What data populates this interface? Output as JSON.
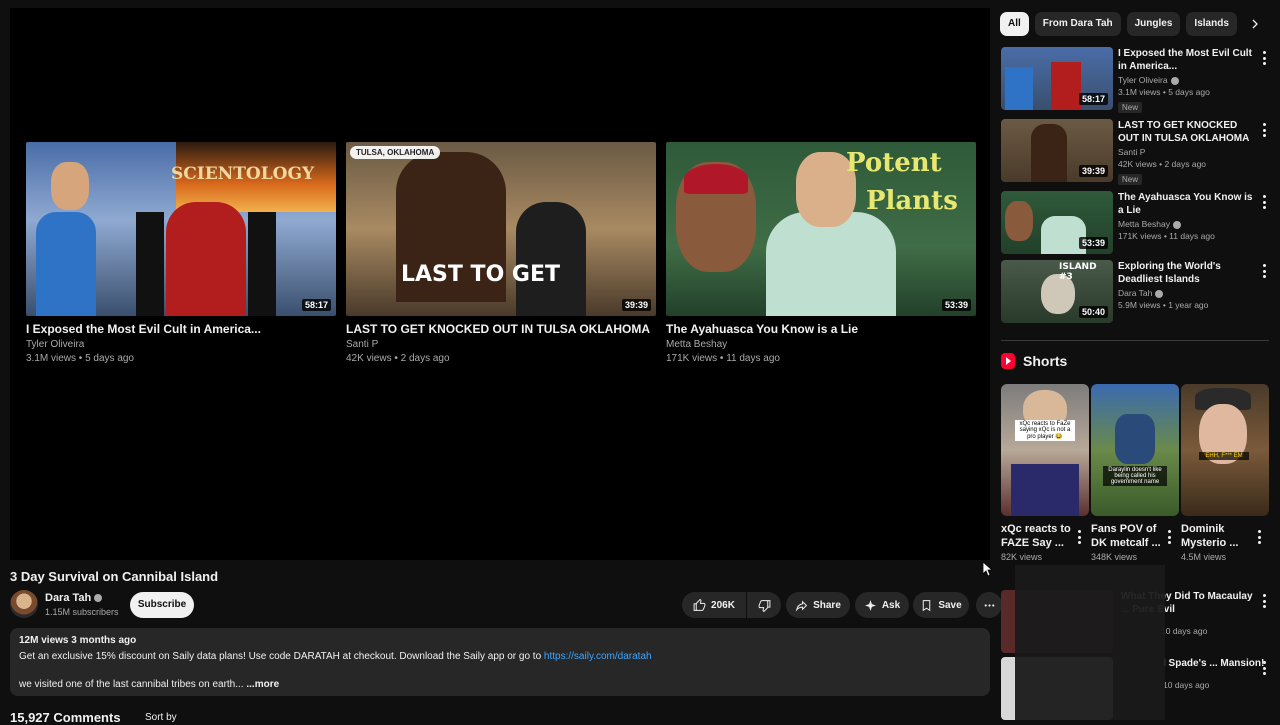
{
  "end_screen": [
    {
      "title": "I Exposed the Most Evil Cult in America...",
      "channel": "Tyler Oliveira",
      "meta": "3.1M views • 5 days ago",
      "duration": "58:17",
      "thumb_text": "SCIENTOLOGY"
    },
    {
      "title": "LAST TO GET KNOCKED OUT IN TULSA OKLAHOMA ‼️ ...",
      "channel": "Santi P",
      "meta": "42K views • 2 days ago",
      "duration": "39:39",
      "location": "TULSA, OKLAHOMA",
      "thumb_text": "LAST TO GET"
    },
    {
      "title": "The Ayahuasca You Know is a Lie",
      "channel": "Metta Beshay",
      "meta": "171K views • 11 days ago",
      "duration": "53:39",
      "thumb_text_1": "Potent",
      "thumb_text_2": "Plants"
    }
  ],
  "video": {
    "title": "3 Day Survival on Cannibal Island",
    "channel": "Dara Tah",
    "subscribers": "1.15M subscribers",
    "subscribe_label": "Subscribe",
    "likes": "206K",
    "share_label": "Share",
    "ask_label": "Ask",
    "save_label": "Save"
  },
  "description": {
    "stats": "12M views  3 months ago",
    "line1": "Get an exclusive 15% discount on Saily data plans! Use code DARATAH at checkout. Download the Saily app or go to ",
    "link": "https://saily.com/daratah",
    "line2": "we visited one of the last cannibal tribes on earth... ",
    "more": "...more"
  },
  "comments": {
    "count": "15,927 Comments",
    "sort_label": "Sort by"
  },
  "chips": [
    "All",
    "From Dara Tah",
    "Jungles",
    "Islands",
    "V"
  ],
  "recommendations": [
    {
      "title": "I Exposed the Most Evil Cult in America...",
      "channel": "Tyler Oliveira",
      "meta": "3.1M views • 5 days ago",
      "badge": "New",
      "duration": "58:17"
    },
    {
      "title": "LAST TO GET KNOCKED OUT IN TULSA OKLAHOMA ‼️ ...",
      "channel": "Santi P",
      "meta": "42K views • 2 days ago",
      "badge": "New",
      "duration": "39:39"
    },
    {
      "title": "The Ayahuasca You Know is a Lie",
      "channel": "Metta Beshay",
      "meta": "171K views • 11 days ago",
      "duration": "53:39"
    },
    {
      "title": "Exploring the World's Deadliest Islands",
      "channel": "Dara Tah",
      "meta": "5.9M views • 1 year ago",
      "duration": "50:40",
      "thumb_text": "ISLAND #3"
    }
  ],
  "shorts": {
    "heading": "Shorts",
    "items": [
      {
        "title": "xQc reacts to FAZE Say ...",
        "views": "82K views",
        "caption": "xQc reacts to FaZe saying xQc is not a pro player 😂"
      },
      {
        "title": "Fans POV of DK metcalf ...",
        "views": "348K views",
        "caption": "Daraylin doesn't like being called his government name"
      },
      {
        "title": "Dominik Mysterio ...",
        "views": "4.5M views",
        "caption": "EHH, F*** EM"
      }
    ]
  },
  "partial_recs": [
    {
      "title": "What They Did To Macaulay ... Pure Evil",
      "meta": "10 days ago"
    },
    {
      "title": "l Spade's ... Mansion!",
      "meta": "10 days ago"
    }
  ]
}
